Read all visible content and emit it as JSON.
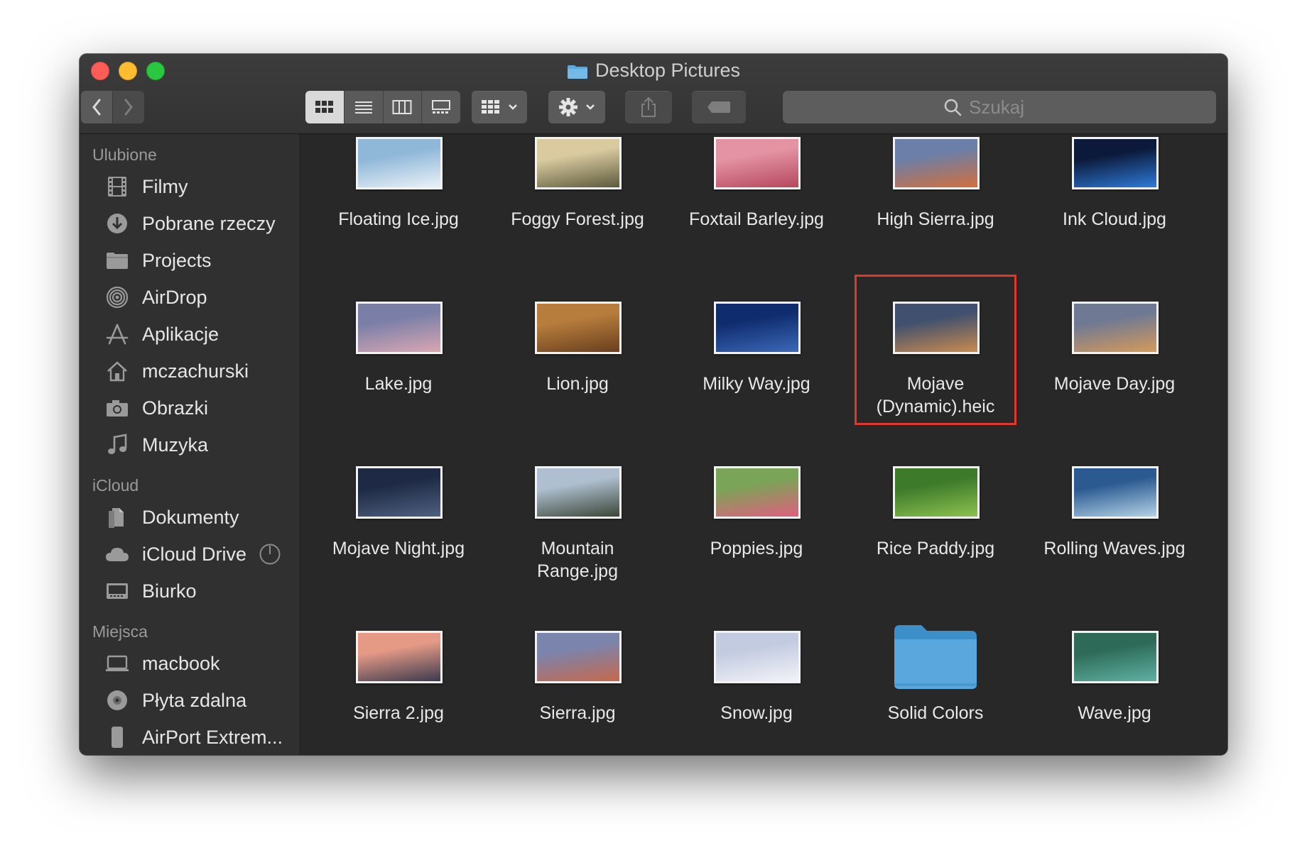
{
  "window": {
    "title": "Desktop Pictures"
  },
  "toolbar": {
    "back_icon": "chevron-left-icon",
    "forward_icon": "chevron-right-icon",
    "view_modes": [
      "icon-view-icon",
      "list-view-icon",
      "column-view-icon",
      "gallery-view-icon"
    ],
    "search_placeholder": "Szukaj"
  },
  "sidebar": {
    "sections": [
      {
        "title": "Ulubione",
        "items": [
          {
            "label": "Filmy",
            "icon": "film-icon"
          },
          {
            "label": "Pobrane rzeczy",
            "icon": "download-icon"
          },
          {
            "label": "Projects",
            "icon": "folder-icon"
          },
          {
            "label": "AirDrop",
            "icon": "airdrop-icon"
          },
          {
            "label": "Aplikacje",
            "icon": "applications-icon"
          },
          {
            "label": "mczachurski",
            "icon": "home-icon"
          },
          {
            "label": "Obrazki",
            "icon": "camera-icon"
          },
          {
            "label": "Muzyka",
            "icon": "music-icon"
          }
        ]
      },
      {
        "title": "iCloud",
        "items": [
          {
            "label": "Dokumenty",
            "icon": "documents-icon"
          },
          {
            "label": "iCloud Drive",
            "icon": "cloud-icon"
          },
          {
            "label": "Biurko",
            "icon": "desktop-icon"
          }
        ]
      },
      {
        "title": "Miejsca",
        "items": [
          {
            "label": "macbook",
            "icon": "laptop-icon"
          },
          {
            "label": "Płyta zdalna",
            "icon": "disc-icon"
          },
          {
            "label": "AirPort Extrem...",
            "icon": "airport-icon"
          }
        ]
      }
    ]
  },
  "files": [
    {
      "name": "Floating Ice.jpg",
      "colors": [
        "#8fb7d8",
        "#e9f1f7"
      ]
    },
    {
      "name": "Foggy Forest.jpg",
      "colors": [
        "#d9caa0",
        "#5d5a3c"
      ]
    },
    {
      "name": "Foxtail Barley.jpg",
      "colors": [
        "#e493a4",
        "#b6475e"
      ]
    },
    {
      "name": "High Sierra.jpg",
      "colors": [
        "#6c7fa8",
        "#d26f3c"
      ]
    },
    {
      "name": "Ink Cloud.jpg",
      "colors": [
        "#0b1a3a",
        "#2f7ad9"
      ]
    },
    {
      "name": "Lake.jpg",
      "colors": [
        "#7b7fa8",
        "#d9a7b3"
      ]
    },
    {
      "name": "Lion.jpg",
      "colors": [
        "#b77d3d",
        "#6a3f1d"
      ]
    },
    {
      "name": "Milky Way.jpg",
      "colors": [
        "#0f2c6e",
        "#3b68b8"
      ]
    },
    {
      "name": "Mojave\n(Dynamic).heic",
      "colors": [
        "#40506e",
        "#c98b4f"
      ]
    },
    {
      "name": "Mojave Day.jpg",
      "colors": [
        "#6f7994",
        "#d59a5b"
      ]
    },
    {
      "name": "Mojave Night.jpg",
      "colors": [
        "#1e2a45",
        "#4e607f"
      ]
    },
    {
      "name": "Mountain\nRange.jpg",
      "colors": [
        "#aebfcf",
        "#3c4638"
      ]
    },
    {
      "name": "Poppies.jpg",
      "colors": [
        "#7aa457",
        "#e0607f"
      ]
    },
    {
      "name": "Rice Paddy.jpg",
      "colors": [
        "#3d7a2a",
        "#8cc14f"
      ]
    },
    {
      "name": "Rolling Waves.jpg",
      "colors": [
        "#2b5a91",
        "#b4d2e6"
      ]
    },
    {
      "name": "Sierra 2.jpg",
      "colors": [
        "#e59a86",
        "#3c3a4e"
      ]
    },
    {
      "name": "Sierra.jpg",
      "colors": [
        "#7b84ad",
        "#c6694b"
      ]
    },
    {
      "name": "Snow.jpg",
      "colors": [
        "#c3cbe0",
        "#f2f3f8"
      ]
    },
    {
      "name": "Solid Colors",
      "colors": [
        "#5aa7dd",
        "#3c8fc8"
      ],
      "is_folder": true
    },
    {
      "name": "Wave.jpg",
      "colors": [
        "#2d6a57",
        "#5fb1a3"
      ]
    }
  ],
  "selected_file": "Mojave\n(Dynamic).heic"
}
